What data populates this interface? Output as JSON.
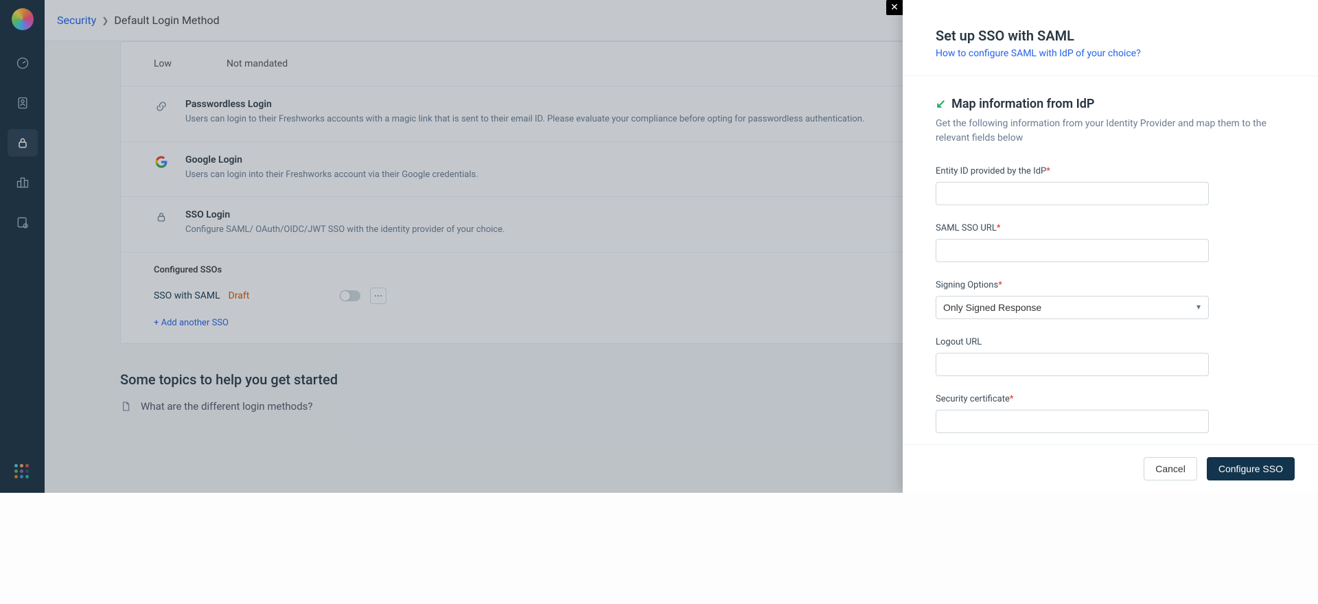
{
  "breadcrumb": {
    "root": "Security",
    "current": "Default Login Method"
  },
  "summary_row": {
    "col1": "Low",
    "col2": "Not mandated"
  },
  "methods": {
    "passwordless": {
      "title": "Passwordless Login",
      "desc": "Users can login to their Freshworks accounts with a magic link that is sent to their email ID. Please evaluate your compliance before opting for passwordless authentication."
    },
    "google": {
      "title": "Google Login",
      "desc": "Users can login into their Freshworks account via their Google credentials."
    },
    "sso": {
      "title": "SSO Login",
      "desc": "Configure SAML/ OAuth/OIDC/JWT SSO with the identity provider of your choice."
    }
  },
  "configured": {
    "heading": "Configured SSOs",
    "item_name": "SSO with SAML",
    "item_status": "Draft",
    "add_link": "+ Add another SSO"
  },
  "help": {
    "heading": "Some topics to help you get started",
    "faq1": "What are the different login methods?"
  },
  "drawer": {
    "title": "Set up SSO with SAML",
    "how_link": "How to configure SAML with IdP of your choice?",
    "section_title": "Map information from IdP",
    "section_desc": "Get the following information from your Identity Provider and map them to the relevant fields below",
    "labels": {
      "entity_id": "Entity ID provided by the IdP",
      "sso_url": "SAML SSO URL",
      "signing": "Signing Options",
      "logout": "Logout URL",
      "cert": "Security certificate"
    },
    "signing_value": "Only Signed Response",
    "buttons": {
      "cancel": "Cancel",
      "confirm": "Configure SSO"
    }
  }
}
